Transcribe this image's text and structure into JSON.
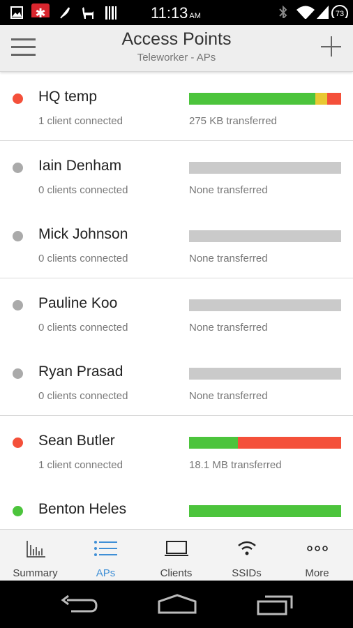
{
  "status_bar": {
    "time": "11:13",
    "ampm": "AM",
    "battery": "73"
  },
  "header": {
    "title": "Access Points",
    "subtitle": "Teleworker - APs"
  },
  "colors": {
    "green": "#4cc43c",
    "yellow": "#e8c832",
    "red": "#f4503a",
    "gray": "#aaaaaa",
    "accent": "#3f8fd6"
  },
  "access_points": [
    {
      "name": "HQ temp",
      "clients": "1 client connected",
      "transfer": "275 KB transferred",
      "status": "red",
      "usage": [
        {
          "color": "green",
          "fraction": 0.83
        },
        {
          "color": "yellow",
          "fraction": 0.08
        },
        {
          "color": "red",
          "fraction": 0.09
        }
      ]
    },
    {
      "name": "Iain Denham",
      "clients": "0 clients connected",
      "transfer": "None transferred",
      "status": "gray",
      "usage": []
    },
    {
      "name": "Mick Johnson",
      "clients": "0 clients connected",
      "transfer": "None transferred",
      "status": "gray",
      "usage": []
    },
    {
      "name": "Pauline Koo",
      "clients": "0 clients connected",
      "transfer": "None transferred",
      "status": "gray",
      "usage": []
    },
    {
      "name": "Ryan Prasad",
      "clients": "0 clients connected",
      "transfer": "None transferred",
      "status": "gray",
      "usage": []
    },
    {
      "name": "Sean Butler",
      "clients": "1 client connected",
      "transfer": "18.1 MB transferred",
      "status": "red",
      "usage": [
        {
          "color": "green",
          "fraction": 0.32
        },
        {
          "color": "red",
          "fraction": 0.68
        }
      ]
    },
    {
      "name": "Benton Heles",
      "clients": "",
      "transfer": "",
      "status": "green",
      "usage": [
        {
          "color": "green",
          "fraction": 1.0
        }
      ]
    }
  ],
  "tabs": [
    {
      "label": "Summary",
      "icon": "bar-chart-icon"
    },
    {
      "label": "APs",
      "icon": "list-icon"
    },
    {
      "label": "Clients",
      "icon": "laptop-icon"
    },
    {
      "label": "SSIDs",
      "icon": "wifi-icon"
    },
    {
      "label": "More",
      "icon": "more-dots-icon"
    }
  ],
  "active_tab": "APs"
}
